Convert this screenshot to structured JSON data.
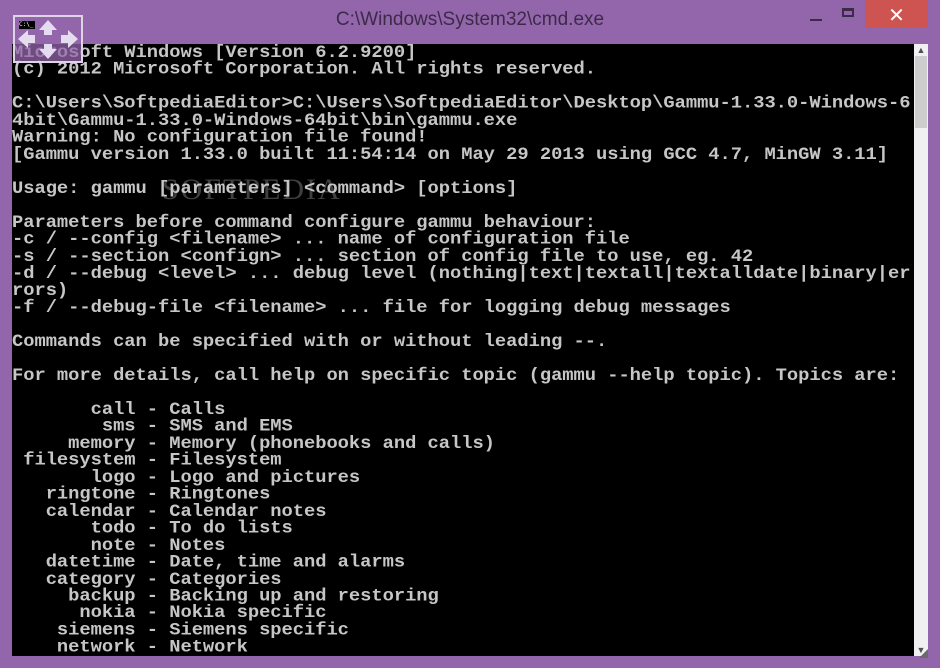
{
  "window": {
    "title": "C:\\Windows\\System32\\cmd.exe",
    "icon": "cmd-move-icon",
    "icon_badge": "C:\\_",
    "controls": {
      "minimize": "–",
      "maximize": "□",
      "close": "✕"
    },
    "colors": {
      "frame": "#9366ab",
      "close": "#cd5450",
      "console_bg": "#000000",
      "console_fg": "#c6c6c6"
    }
  },
  "console": {
    "watermark": "SOFTPEDIA",
    "lines": [
      "Microsoft Windows [Version 6.2.9200]",
      "(c) 2012 Microsoft Corporation. All rights reserved.",
      "",
      "C:\\Users\\SoftpediaEditor>C:\\Users\\SoftpediaEditor\\Desktop\\Gammu-1.33.0-Windows-6",
      "4bit\\Gammu-1.33.0-Windows-64bit\\bin\\gammu.exe",
      "Warning: No configuration file found!",
      "[Gammu version 1.33.0 built 11:54:14 on May 29 2013 using GCC 4.7, MinGW 3.11]",
      "",
      "Usage: gammu [parameters] <command> [options]",
      "",
      "Parameters before command configure gammu behaviour:",
      "-c / --config <filename> ... name of configuration file",
      "-s / --section <confign> ... section of config file to use, eg. 42",
      "-d / --debug <level> ... debug level (nothing|text|textall|textalldate|binary|er",
      "rors)",
      "-f / --debug-file <filename> ... file for logging debug messages",
      "",
      "Commands can be specified with or without leading --.",
      "",
      "For more details, call help on specific topic (gammu --help topic). Topics are:",
      "",
      "       call - Calls",
      "        sms - SMS and EMS",
      "     memory - Memory (phonebooks and calls)",
      " filesystem - Filesystem",
      "       logo - Logo and pictures",
      "   ringtone - Ringtones",
      "   calendar - Calendar notes",
      "       todo - To do lists",
      "       note - Notes",
      "   datetime - Date, time and alarms",
      "   category - Categories",
      "     backup - Backing up and restoring",
      "      nokia - Nokia specific",
      "    siemens - Siemens specific",
      "    network - Network"
    ]
  },
  "scrollbar": {
    "up_arrow": "▲",
    "down_arrow": "▼",
    "position_fraction": 0.0
  }
}
